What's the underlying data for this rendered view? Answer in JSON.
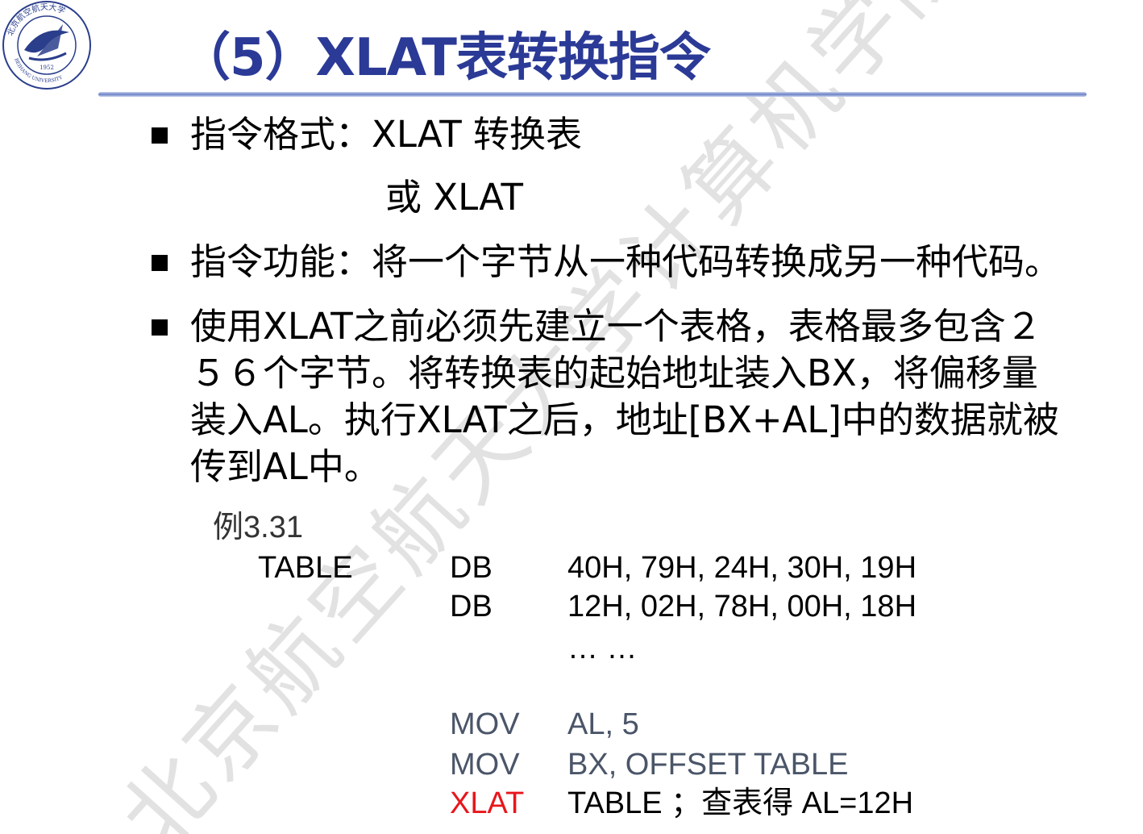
{
  "title": "（5）XLAT表转换指令",
  "bullets": {
    "format_label": "指令格式：XLAT  转换表",
    "format_alt": "或   XLAT",
    "function": "指令功能：将一个字节从一种代码转换成另一种代码。",
    "usage_lines": [
      "使用XLAT之前必须先建立一个表格，表格最多包含２",
      "５６个字节。将转换表的起始地址装入BX，将偏移量",
      "装入AL。执行XLAT之后，地址[BX+AL]中的数据就被",
      "传到AL中。"
    ]
  },
  "example": {
    "label": "例3.31",
    "table_name": "TABLE",
    "db_rows": [
      {
        "op": "DB",
        "args": "40H, 79H, 24H, 30H, 19H"
      },
      {
        "op": "DB",
        "args": "12H, 02H, 78H, 00H, 18H"
      }
    ],
    "ellipsis": "… …",
    "instructions": [
      {
        "op": "MOV",
        "args": "AL, 5"
      },
      {
        "op": "MOV",
        "args": "BX, OFFSET TABLE"
      },
      {
        "op": "XLAT",
        "args": "TABLE  ；查表得   AL=12H"
      }
    ]
  },
  "watermark": "北京航空航天大学计算机学院 林",
  "logo": {
    "top_text": "北京航空航天大学",
    "bottom_text": "BEIHANG UNIVERSITY",
    "year": "1952"
  },
  "colors": {
    "title": "#2b3a96",
    "accent_red": "#e8161b",
    "watermark": "#d9d9d9"
  }
}
